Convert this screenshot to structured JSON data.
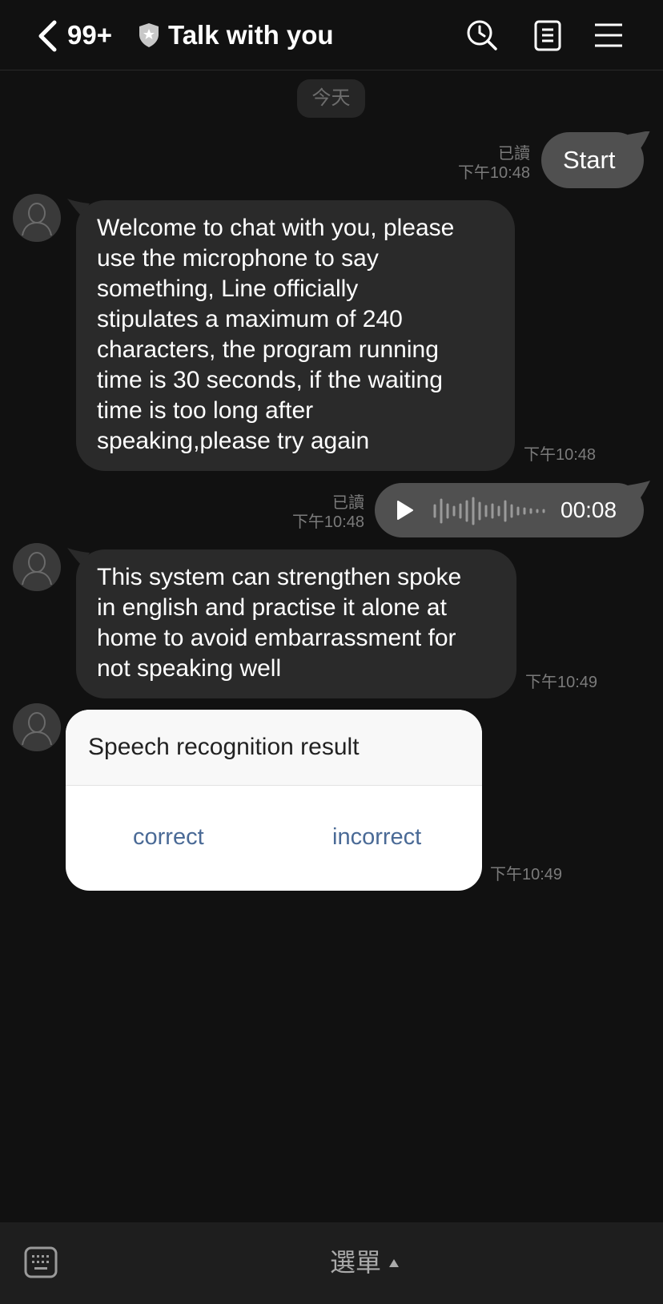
{
  "header": {
    "unread_count": "99+",
    "title": "Talk with you",
    "icons": [
      "back-chevron-icon",
      "shield-star-icon",
      "search-clock-icon",
      "notes-icon",
      "menu-icon"
    ]
  },
  "date_separator": "今天",
  "messages": [
    {
      "side": "out",
      "read_label": "已讀",
      "time": "下午10:48",
      "text": "Start"
    },
    {
      "side": "in",
      "time": "下午10:48",
      "lines": [
        "Welcome to chat with you, please",
        "use the microphone to say",
        "something, Line officially",
        "stipulates a maximum of 240",
        "characters, the program running",
        "time is 30 seconds, if the waiting",
        "time is too long after",
        "speaking,please try again"
      ]
    },
    {
      "side": "out",
      "type": "voice",
      "read_label": "已讀",
      "time": "下午10:48",
      "duration": "00:08"
    },
    {
      "side": "in",
      "time": "下午10:49",
      "lines": [
        "This system can strengthen spoke",
        "in english and practise it alone at",
        "home to avoid embarrassment for",
        "not speaking well"
      ]
    },
    {
      "side": "in",
      "type": "card",
      "time": "下午10:49",
      "title": "Speech recognition result",
      "buttons": [
        "correct",
        "incorrect"
      ]
    }
  ],
  "bottom_bar": {
    "menu_label": "選單",
    "icons": [
      "keyboard-icon",
      "caret-up-icon"
    ]
  },
  "colors": {
    "background": "#111111",
    "bubble_out": "#505050",
    "bubble_in": "#2a2a2a",
    "card_button_text": "#4a6a96",
    "timestamp": "#7b7b7b"
  }
}
